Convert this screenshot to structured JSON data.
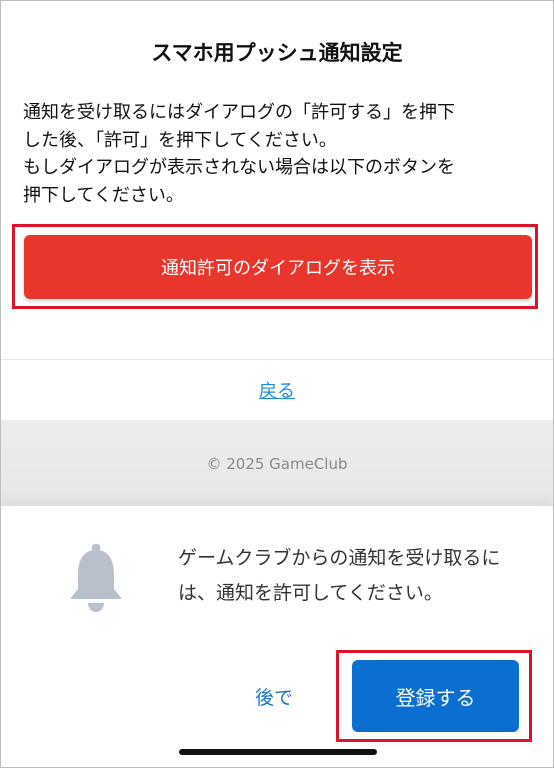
{
  "page": {
    "title": "スマホ用プッシュ通知設定",
    "description_lines": [
      "通知を受け取るにはダイアログの「許可する」を押下",
      "した後、「許可」を押下してください。",
      "もしダイアログが表示されない場合は以下のボタンを",
      "押下してください。"
    ],
    "show_dialog_button": "通知許可のダイアログを表示",
    "back_link": "戻る",
    "copyright": "© 2025 GameClub",
    "colors": {
      "primary_red": "#e8362d",
      "highlight_red": "#e0122b",
      "link_blue": "#1e88e5",
      "button_blue": "#0b6fd1"
    }
  },
  "permission_sheet": {
    "icon": "bell-icon",
    "message": "ゲームクラブからの通知を受け取るには、通知を許可してください。",
    "later_button": "後で",
    "register_button": "登録する"
  }
}
